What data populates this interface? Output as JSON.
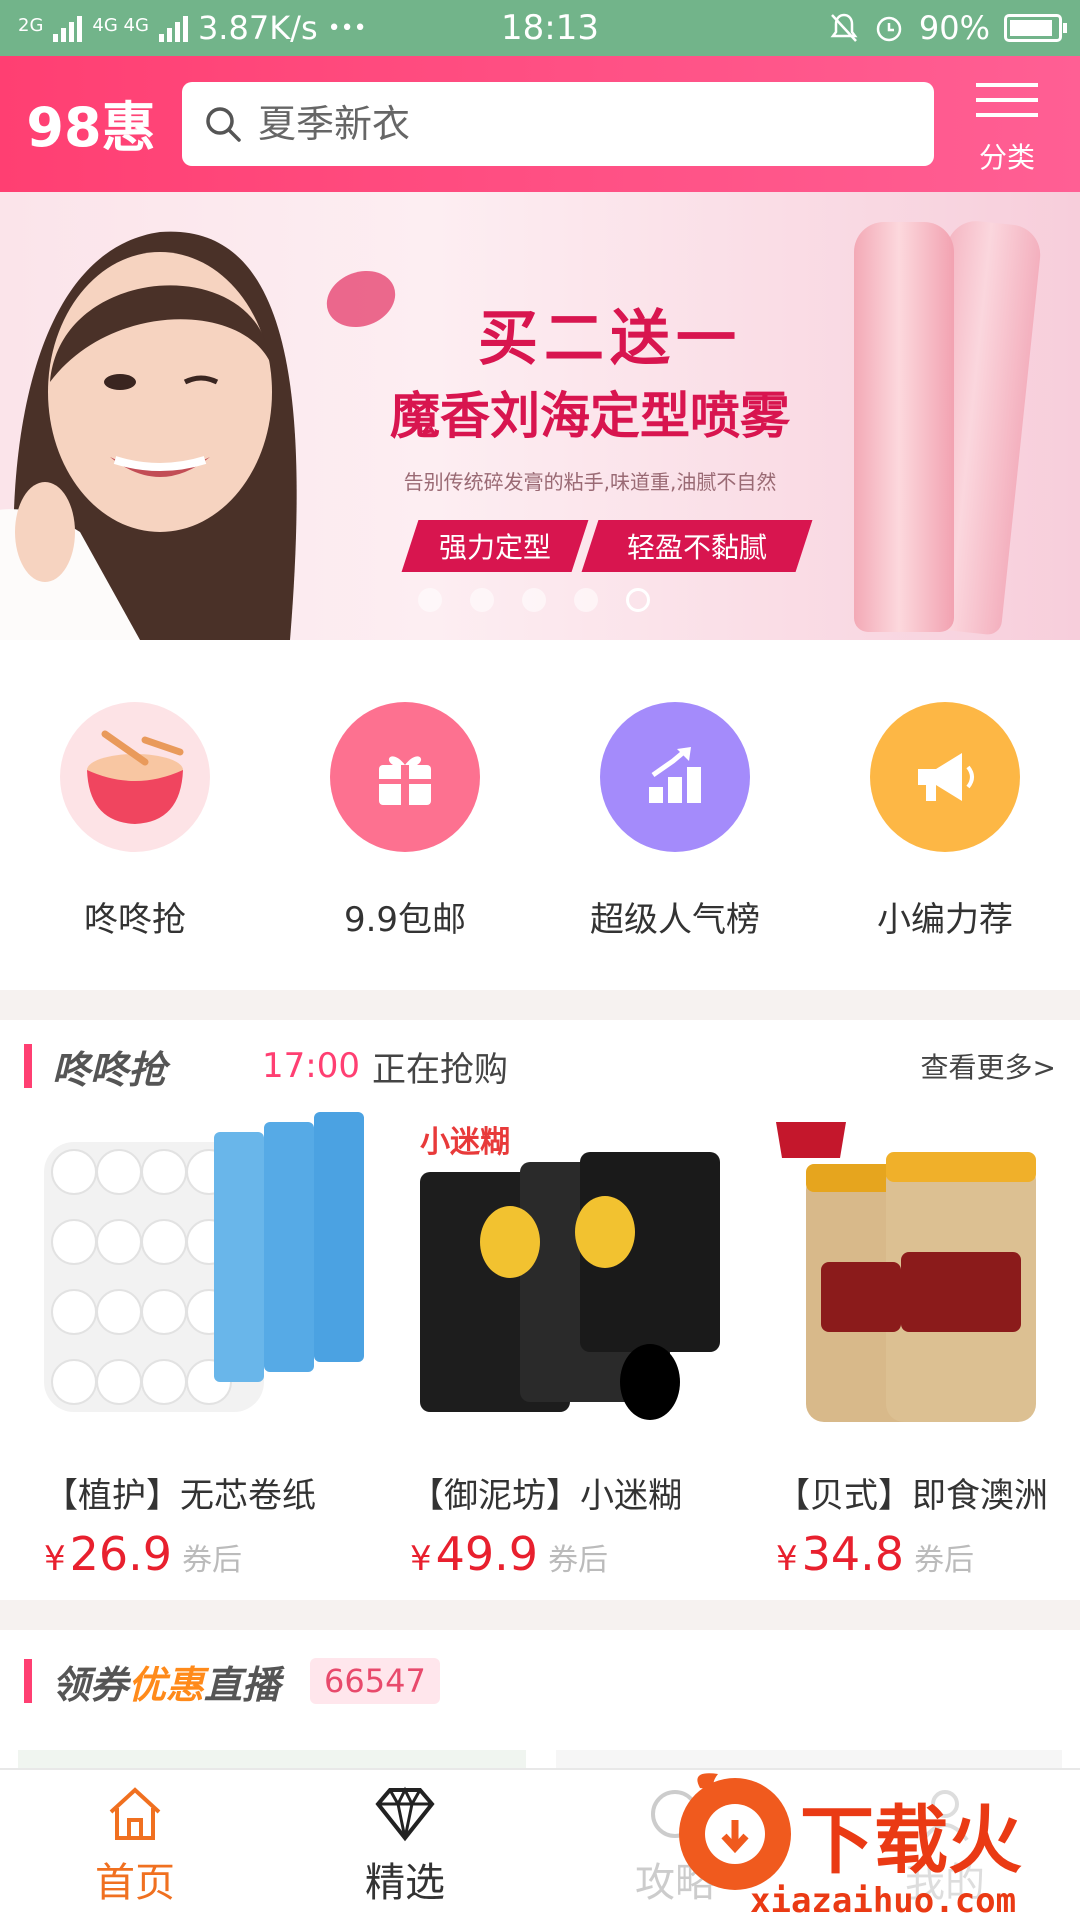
{
  "status_bar": {
    "net1": "2G",
    "net2": "4G 4G",
    "speed": "3.87K/s",
    "dots": "•••",
    "time": "18:13",
    "battery": "90%"
  },
  "header": {
    "logo": "98惠",
    "search_placeholder": "夏季新衣",
    "category_label": "分类"
  },
  "banner": {
    "title": "买二送一",
    "subtitle": "魔香刘海定型喷雾",
    "description": "告别传统碎发膏的粘手,味道重,油腻不自然",
    "tag1": "强力定型",
    "tag2": "轻盈不黏腻",
    "pages": 5,
    "active_page": 5
  },
  "quick_icons": [
    {
      "label": "咚咚抢",
      "icon": "drum-icon",
      "color": "#f7677e"
    },
    {
      "label": "9.9包邮",
      "icon": "gift-icon",
      "color": "#fd7190"
    },
    {
      "label": "超级人气榜",
      "icon": "chart-up-icon",
      "color": "#a48bfb"
    },
    {
      "label": "小编力荐",
      "icon": "megaphone-icon",
      "color": "#fdb745"
    }
  ],
  "flash_sale": {
    "title": "咚咚抢",
    "time": "17:00",
    "status": "正在抢购",
    "more": "查看更多>",
    "products": [
      {
        "name": "【植护】无芯卷纸",
        "currency": "¥",
        "price": "26.9",
        "after": "券后",
        "img": "toilet-paper"
      },
      {
        "name": "【御泥坊】小迷糊",
        "currency": "¥",
        "price": "49.9",
        "after": "券后",
        "img": "face-mask"
      },
      {
        "name": "【贝式】即食澳洲",
        "currency": "¥",
        "price": "34.8",
        "after": "券后",
        "img": "oatmeal"
      }
    ]
  },
  "coupon": {
    "title_a": "领券",
    "title_b": "优惠",
    "title_c": "直播",
    "count": "66547"
  },
  "tabs": [
    {
      "label": "首页",
      "icon": "home-icon",
      "active": true
    },
    {
      "label": "精选",
      "icon": "diamond-icon",
      "active": false
    },
    {
      "label": "攻略",
      "icon": "guide-icon",
      "active": false
    },
    {
      "label": "我的",
      "icon": "user-icon",
      "active": false
    }
  ],
  "watermark": {
    "brand": "下载火",
    "url": "xiazaihuo.com"
  },
  "colors": {
    "brand": "#ff3f72",
    "price": "#e8202e",
    "active_tab": "#f07020",
    "status_bar": "#72b48a"
  }
}
